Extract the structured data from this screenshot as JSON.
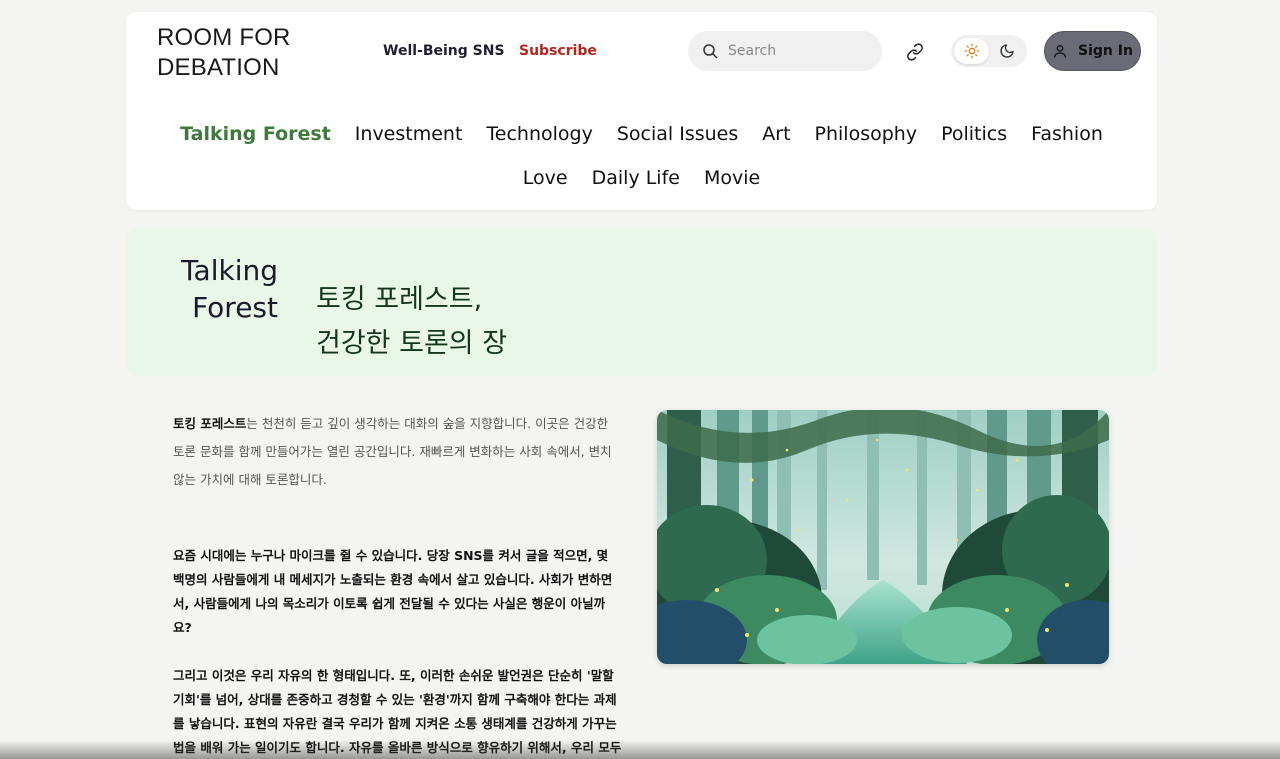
{
  "header": {
    "logo_line1": "ROOM FOR",
    "logo_line2": "DEBATION",
    "nav_sns": "Well-Being SNS",
    "nav_subscribe": "Subscribe",
    "search_placeholder": "Search",
    "sign_in": "Sign In",
    "theme": "light"
  },
  "categories": {
    "row1": [
      "Talking Forest",
      "Investment",
      "Technology",
      "Social Issues",
      "Art",
      "Philosophy",
      "Politics",
      "Fashion"
    ],
    "row2": [
      "Love",
      "Daily Life",
      "Movie"
    ],
    "active": "Talking Forest"
  },
  "hero": {
    "title_line1": "Talking",
    "title_line2": "Forest",
    "subtitle_line1": "토킹 포레스트,",
    "subtitle_line2": "건강한 토론의 장"
  },
  "content": {
    "intro_bold": "토킹 포레스트",
    "intro_rest": "는 천천히 듣고 깊이 생각하는 대화의 숲을 지향합니다. 이곳은 건강한 토론 문화를 함께 만들어가는 열린 공간입니다. 재빠르게 변화하는 사회 속에서, 변치 않는 가치에 대해 토론합니다.",
    "paragraph1": "요즘 시대에는 누구나 마이크를 쥘 수 있습니다. 당장 SNS를 켜서 글을 적으면, 몇 백명의 사람들에게 내 메세지가 노출되는 환경 속에서 살고 있습니다. 사회가 변하면서, 사람들에게 나의 목소리가 이토록 쉽게 전달될 수 있다는 사실은 행운이 아닐까요?",
    "paragraph2": "그리고 이것은 우리 자유의 한 형태입니다. 또, 이러한 손쉬운 발언권은 단순히 '말할 기회'를 넘어, 상대를 존중하고 경청할 수 있는 '환경'까지 함께 구축해야 한다는 과제를 낳습니다. 표현의 자유란 결국 우리가 함께 지켜온 소통 생태계를 건강하게 가꾸는 법을 배워 가는 일이기도 합니다. 자유를 올바른 방식으로 향유하기 위해서, 우리 모두가 함께 책임지는 것을 다시 봅니다."
  },
  "colors": {
    "accent_green": "#3f7a3c",
    "subscribe_red": "#b3261e",
    "hero_bg": "#e8f7e8"
  }
}
